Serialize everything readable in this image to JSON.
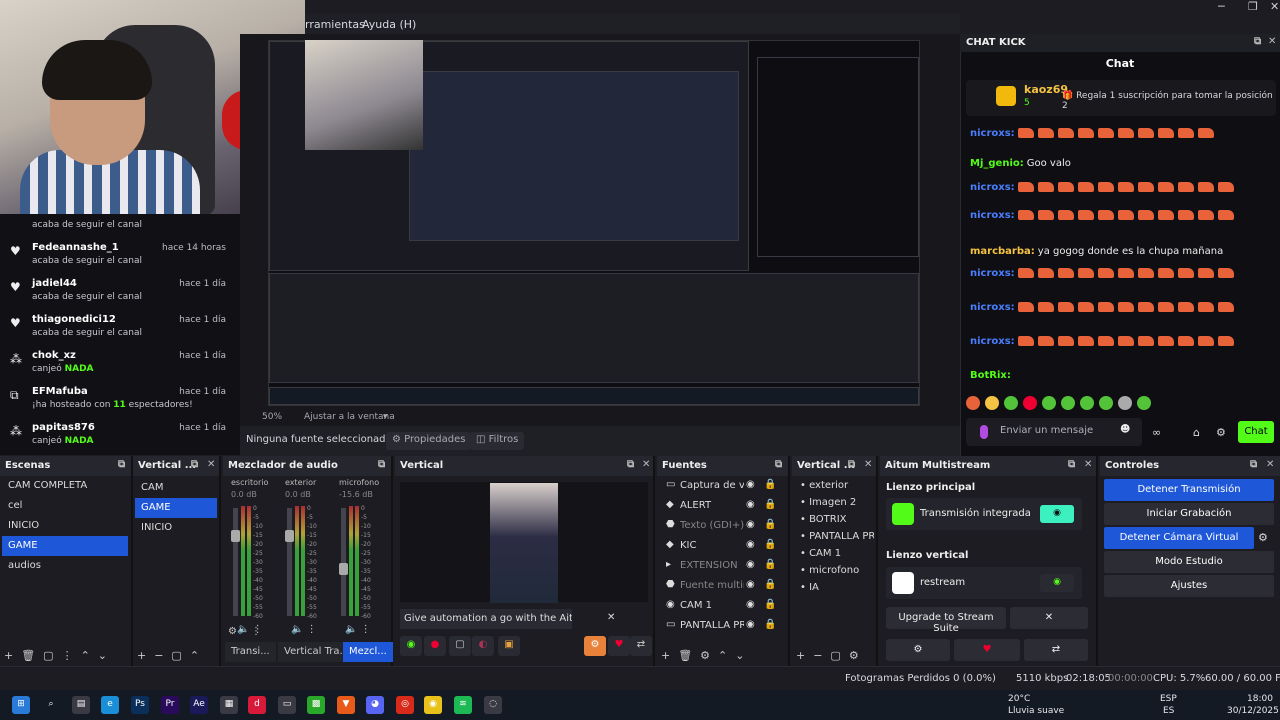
{
  "menu": {
    "herramientas": "rramientas",
    "ayuda": "Ayuda (H)"
  },
  "window_controls": {
    "minimize": "─",
    "maximize": "❐",
    "close": "✕"
  },
  "feed": [
    {
      "icon": "",
      "name": "",
      "time": "",
      "sub_pre": "acaba de seguir el canal",
      "sub_bold": "",
      "sub_post": ""
    },
    {
      "icon": "♥",
      "name": "Fedeannashe_1",
      "time": "hace 14 horas",
      "sub_pre": "acaba de seguir el canal",
      "sub_bold": "",
      "sub_post": ""
    },
    {
      "icon": "♥",
      "name": "jadiel44",
      "time": "hace 1 día",
      "sub_pre": "acaba de seguir el canal",
      "sub_bold": "",
      "sub_post": ""
    },
    {
      "icon": "♥",
      "name": "thiagonedici12",
      "time": "hace 1 día",
      "sub_pre": "acaba de seguir el canal",
      "sub_bold": "",
      "sub_post": ""
    },
    {
      "icon": "⁂",
      "name": "chok_xz",
      "time": "hace 1 día",
      "sub_pre": "canjeó ",
      "sub_bold": "NADA",
      "sub_post": ""
    },
    {
      "icon": "⧉",
      "name": "EFMafuba",
      "time": "hace 1 día",
      "sub_pre": "¡ha hosteado con ",
      "sub_bold": "11",
      "sub_post": " espectadores!"
    },
    {
      "icon": "⁂",
      "name": "papitas876",
      "time": "hace 1 día",
      "sub_pre": "canjeó ",
      "sub_bold": "NADA",
      "sub_post": ""
    }
  ],
  "preview_bar": {
    "zoom": "50%",
    "fit": "Ajustar a la ventana"
  },
  "source_bar": {
    "none": "Ninguna fuente seleccionad",
    "props": "Propiedades",
    "filters": "Filtros"
  },
  "chat": {
    "dock_title": "CHAT KICK",
    "header": "Chat",
    "pinned": {
      "user": "kaoz69",
      "count": "5",
      "text": "Regala 1 suscripción para tomar la posición 2"
    },
    "lines": [
      {
        "user": "nicroxs:",
        "color": "#4a7dff",
        "text": "",
        "emotes": 10
      },
      {
        "user": "Mj_genio:",
        "color": "#53fc18",
        "text": "Goo valo",
        "emotes": 0
      },
      {
        "user": "nicroxs:",
        "color": "#4a7dff",
        "text": "",
        "emotes": 11
      },
      {
        "user": "nicroxs:",
        "color": "#4a7dff",
        "text": "",
        "emotes": 11
      },
      {
        "user": "marcbarba:",
        "color": "#f5c343",
        "text": "ya gogog donde es la chupa mañana",
        "emotes": 0
      },
      {
        "user": "nicroxs:",
        "color": "#4a7dff",
        "text": "",
        "emotes": 11
      },
      {
        "user": "nicroxs:",
        "color": "#4a7dff",
        "text": "",
        "emotes": 11
      },
      {
        "user": "nicroxs:",
        "color": "#4a7dff",
        "text": "",
        "emotes": 11
      },
      {
        "user": "BotRix:",
        "color": "#53fc18",
        "text": "",
        "emotes": 0
      }
    ],
    "input_placeholder": "Enviar un mensaje",
    "send": "Chat"
  },
  "scenes": {
    "title": "Escenas",
    "items": [
      "CAM COMPLETA",
      "cel",
      "INICIO",
      "GAME",
      "audios"
    ],
    "selected": 3
  },
  "vertical_scenes": {
    "title": "Vertical ...",
    "items": [
      "CAM",
      "GAME",
      "INICIO"
    ],
    "selected": 1
  },
  "mixer": {
    "title": "Mezclador de audio",
    "channels": [
      {
        "name": "escritorio",
        "db": "0.0 dB"
      },
      {
        "name": "exterior",
        "db": "0.0 dB"
      },
      {
        "name": "microfono",
        "db": "-15.6 dB"
      }
    ],
    "scale": [
      "0",
      "-5",
      "-10",
      "-15",
      "-20",
      "-25",
      "-30",
      "-35",
      "-40",
      "-45",
      "-50",
      "-55",
      "-60"
    ],
    "tabs": [
      "Transi...",
      "Vertical Tra...",
      "Mezcl..."
    ]
  },
  "vertical": {
    "title": "Vertical",
    "banner": "Give automation a go with the Aitum App"
  },
  "sources": {
    "title": "Fuentes",
    "items": [
      {
        "icon": "▭",
        "name": "Captura de ven",
        "dim": false
      },
      {
        "icon": "◆",
        "name": "ALERT",
        "dim": false
      },
      {
        "icon": "⬣",
        "name": "Texto (GDI+)",
        "dim": true
      },
      {
        "icon": "◆",
        "name": "KIC",
        "dim": false
      },
      {
        "icon": "▸",
        "name": "EXTENSION",
        "dim": true
      },
      {
        "icon": "⬣",
        "name": "Fuente multime",
        "dim": true
      },
      {
        "icon": "◉",
        "name": "CAM 1",
        "dim": false
      },
      {
        "icon": "▭",
        "name": "PANTALLA PRIN",
        "dim": false
      }
    ]
  },
  "vertical_sources": {
    "title": "Vertical ...",
    "items": [
      "exterior",
      "Imagen 2",
      "BOTRIX",
      "PANTALLA PRIN",
      "CAM 1",
      "microfono",
      "IA"
    ]
  },
  "aitum": {
    "title": "Aitum Multistream",
    "main_canvas": "Lienzo principal",
    "main_stream": "Transmisión integrada",
    "vertical_canvas": "Lienzo vertical",
    "vertical_stream": "restream",
    "upgrade": "Upgrade to Stream Suite"
  },
  "controls": {
    "title": "Controles",
    "buttons": [
      {
        "label": "Detener Transmisión",
        "blue": true
      },
      {
        "label": "Iniciar Grabación",
        "blue": false
      },
      {
        "label": "Detener Cámara Virtual",
        "blue": true
      },
      {
        "label": "Modo Estudio",
        "blue": false
      },
      {
        "label": "Ajustes",
        "blue": false
      }
    ]
  },
  "status": {
    "frames": "Fotogramas Perdidos 0 (0.0%)",
    "kbps": "5110 kbps",
    "stream_time": "02:18:05",
    "rec_time": "00:00:00",
    "cpu": "CPU: 5.7%",
    "fps": "60.00 / 60.00 FPS"
  },
  "tray": {
    "temp": "20°C",
    "weather": "Lluvia suave",
    "lang1": "ESP",
    "lang2": "ES",
    "time": "18:00",
    "date": "30/12/2025"
  },
  "colors": {
    "accent": "#1e57d8",
    "kick_green": "#53fc18",
    "bg": "#1c1c22"
  }
}
